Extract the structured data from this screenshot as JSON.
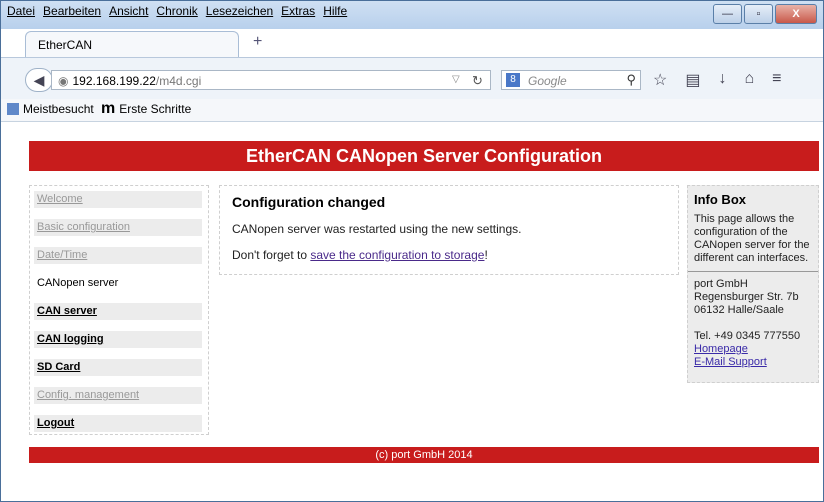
{
  "menu": [
    "Datei",
    "Bearbeiten",
    "Ansicht",
    "Chronik",
    "Lesezeichen",
    "Extras",
    "Hilfe"
  ],
  "tab": {
    "title": "EtherCAN",
    "newtab": "+"
  },
  "window_controls": {
    "minimize": "—",
    "maximize": "▫",
    "close": "X"
  },
  "navbar": {
    "url_host": "192.168.199.22",
    "url_path": "/m4d.cgi",
    "search_placeholder": "Google",
    "search_engine_letter": "8"
  },
  "bookmarks": [
    {
      "label": "Meistbesucht"
    },
    {
      "label": "Erste Schritte"
    }
  ],
  "page": {
    "header": "EtherCAN CANopen Server Configuration",
    "sidebar": [
      {
        "label": "Welcome"
      },
      {
        "label": "Basic configuration"
      },
      {
        "label": "Date/Time"
      },
      {
        "label": "CANopen server"
      },
      {
        "label": "CAN server"
      },
      {
        "label": "CAN logging"
      },
      {
        "label": "SD Card"
      },
      {
        "label": "Config. management"
      },
      {
        "label": "Logout"
      }
    ],
    "content": {
      "title": "Configuration changed",
      "line1": "CANopen server was restarted using the new settings.",
      "line2_prefix": "Don't forget to ",
      "line2_link": "save the configuration to storage",
      "line2_suffix": "!"
    },
    "infobox": {
      "title": "Info Box",
      "text": "This page allows the configuration of the CANopen server for the different can interfaces.",
      "company": "port GmbH",
      "street": "Regensburger Str. 7b",
      "city": "06132 Halle/Saale",
      "tel": "Tel. +49 0345 777550",
      "homepage": "Homepage",
      "support": "E-Mail Support"
    },
    "footer": "(c) port GmbH 2014"
  }
}
